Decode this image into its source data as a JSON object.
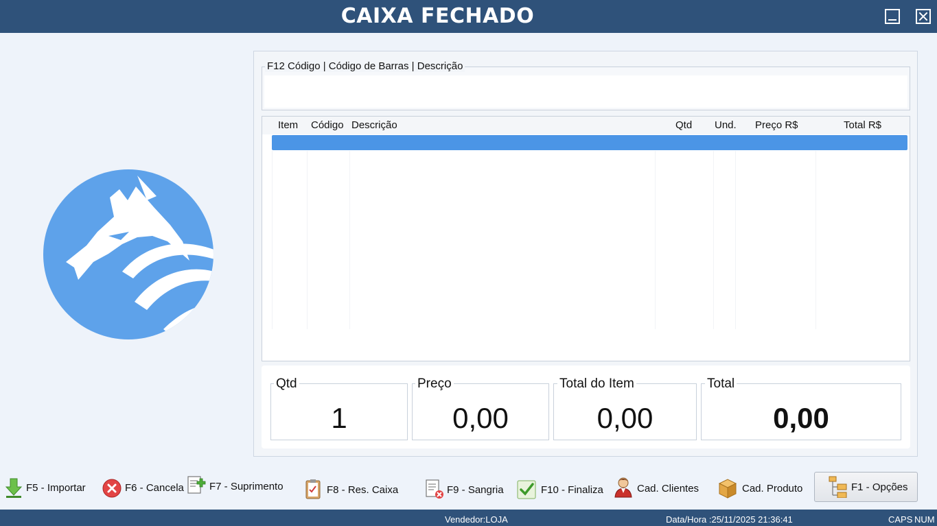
{
  "window": {
    "title": "CAIXA FECHADO"
  },
  "search": {
    "legend": "F12  Código | Código de Barras | Descrição",
    "value": "",
    "placeholder": ""
  },
  "grid": {
    "columns": [
      "Item",
      "Código",
      "Descrição",
      "Qtd",
      "Und.",
      "Preço R$",
      "Total R$"
    ]
  },
  "totals": {
    "qtd": {
      "label": "Qtd",
      "value": "1"
    },
    "preco": {
      "label": "Preço",
      "value": "0,00"
    },
    "total_item": {
      "label": "Total do Item",
      "value": "0,00"
    },
    "total": {
      "label": "Total",
      "value": "0,00"
    }
  },
  "toolbar": {
    "importar": "F5 - Importar",
    "cancela": "F6 - Cancela",
    "suprimento": "F7 - Suprimento",
    "res_caixa": "F8 - Res. Caixa",
    "sangria": "F9 - Sangria",
    "finaliza": "F10 - Finaliza",
    "cad_clientes": "Cad. Clientes",
    "cad_produto": "Cad. Produto",
    "opcoes": "F1 - Opções"
  },
  "status": {
    "vendedor": "Vendedor:LOJA",
    "datahora": "Data/Hora :25/11/2025 21:36:41",
    "caps": "CAPS",
    "num": "NUM"
  },
  "colors": {
    "bar": "#2f527a",
    "accent": "#4b95e6",
    "logo": "#5ea2ea"
  },
  "icons": {
    "logo": "wolf-logo-icon",
    "importar": "download-arrow-icon",
    "cancela": "cancel-x-icon",
    "suprimento": "document-add-icon",
    "res_caixa": "clipboard-check-icon",
    "sangria": "document-remove-icon",
    "finaliza": "checkmark-icon",
    "cad_clientes": "user-icon",
    "cad_produto": "box-icon",
    "opcoes": "tree-options-icon"
  }
}
